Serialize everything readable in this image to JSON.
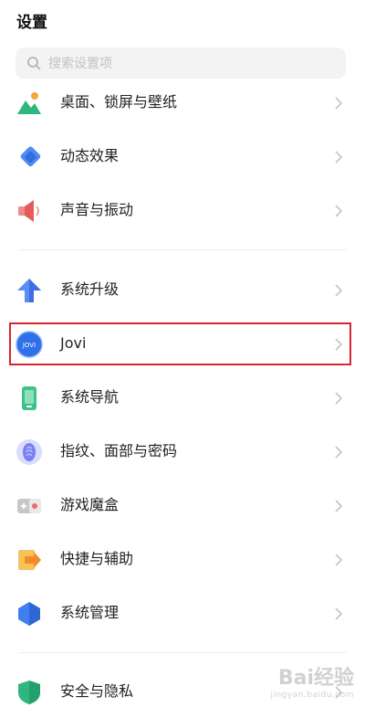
{
  "header": {
    "title": "设置"
  },
  "search": {
    "placeholder": "搜索设置项"
  },
  "groups": [
    {
      "items": [
        {
          "label": "桌面、锁屏与壁纸",
          "icon": "wallpaper-icon"
        },
        {
          "label": "动态效果",
          "icon": "motion-effects-icon"
        },
        {
          "label": "声音与振动",
          "icon": "speaker-icon"
        }
      ]
    },
    {
      "items": [
        {
          "label": "系统升级",
          "icon": "system-upgrade-icon"
        },
        {
          "label": "Jovi",
          "icon": "jovi-icon",
          "icon_text": "JOVI"
        },
        {
          "label": "系统导航",
          "icon": "system-navigation-icon"
        },
        {
          "label": "指纹、面部与密码",
          "icon": "fingerprint-icon"
        },
        {
          "label": "游戏魔盒",
          "icon": "game-box-icon"
        },
        {
          "label": "快捷与辅助",
          "icon": "shortcut-icon"
        },
        {
          "label": "系统管理",
          "icon": "system-management-icon"
        }
      ]
    },
    {
      "items": [
        {
          "label": "安全与隐私",
          "icon": "security-privacy-icon"
        }
      ]
    }
  ],
  "watermark": {
    "text": "Bai经验",
    "subtext": "jingyan.baidu.com"
  },
  "colors": {
    "highlight": "#d8252f",
    "accent": "#3b82f6"
  }
}
